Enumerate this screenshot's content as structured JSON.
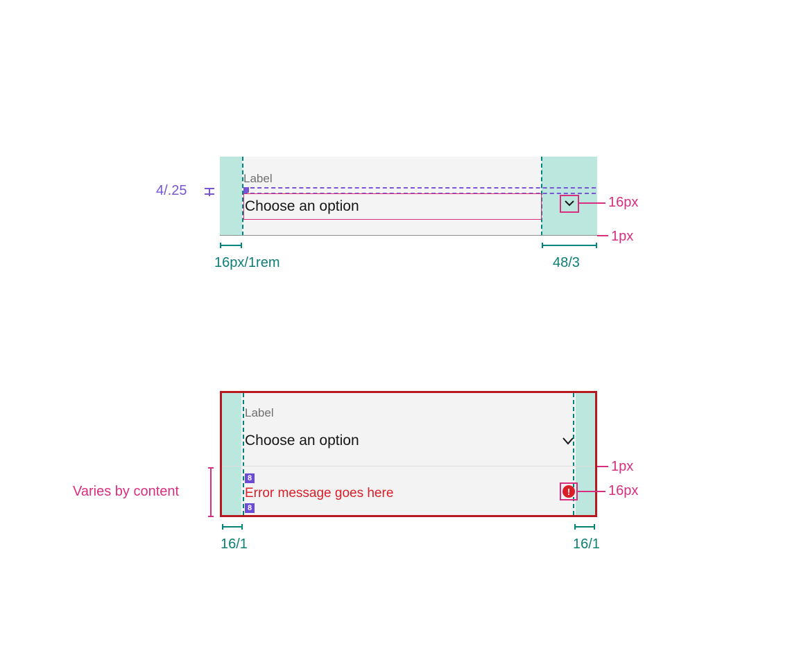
{
  "diagram1": {
    "label": "Label",
    "option_text": "Choose an option",
    "annotations": {
      "purple_gap": "4/.25",
      "chevron_callout": "16px",
      "rule_callout": "1px",
      "left_padding": "16px/1rem",
      "right_padding": "48/3"
    }
  },
  "diagram2": {
    "label": "Label",
    "option_text": "Choose an option",
    "error_text": "Error message goes here",
    "tag_value": "8",
    "annotations": {
      "rule_callout": "1px",
      "warning_callout": "16px",
      "left_padding": "16/1",
      "right_padding": "16/1",
      "height_note": "Varies by content"
    }
  }
}
